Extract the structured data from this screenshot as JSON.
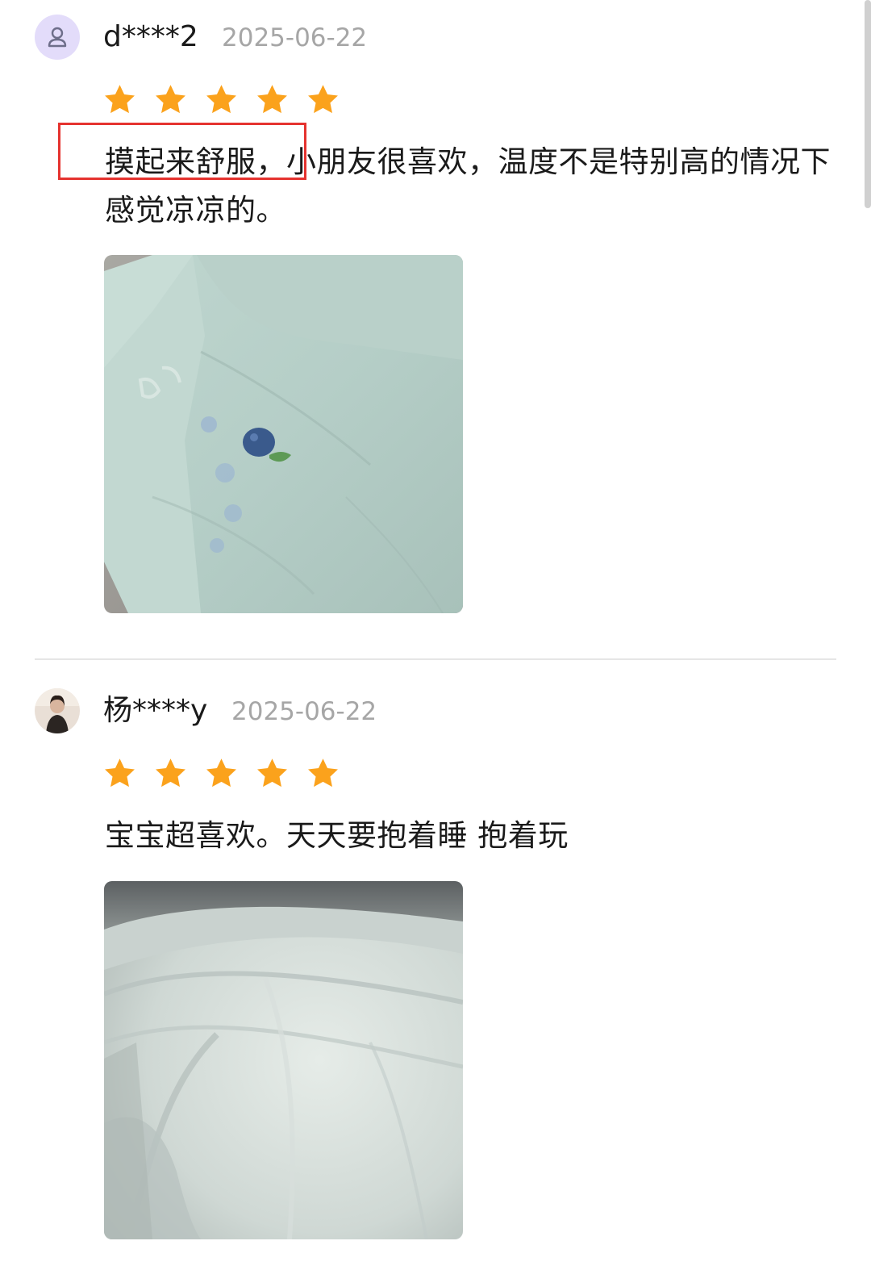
{
  "reviews": [
    {
      "username": "d****2",
      "date": "2025-06-22",
      "rating": 5,
      "text": "摸起来舒服，小朋友很喜欢，温度不是特别高的情况下感觉凉凉的。",
      "avatar_icon": "user-silhouette-icon",
      "photo": "light-green-blanket-with-blueberry-print"
    },
    {
      "username": "杨****y",
      "date": "2025-06-22",
      "rating": 5,
      "text": "宝宝超喜欢。天天要抱着睡 抱着玩",
      "avatar_icon": "profile-photo",
      "photo": "pale-blue-blanket-folds"
    }
  ],
  "colors": {
    "star": "#FBA21C",
    "highlight": "#E5332F",
    "date": "#A6A6A6",
    "avatar_bg": "#E3DCFA"
  }
}
